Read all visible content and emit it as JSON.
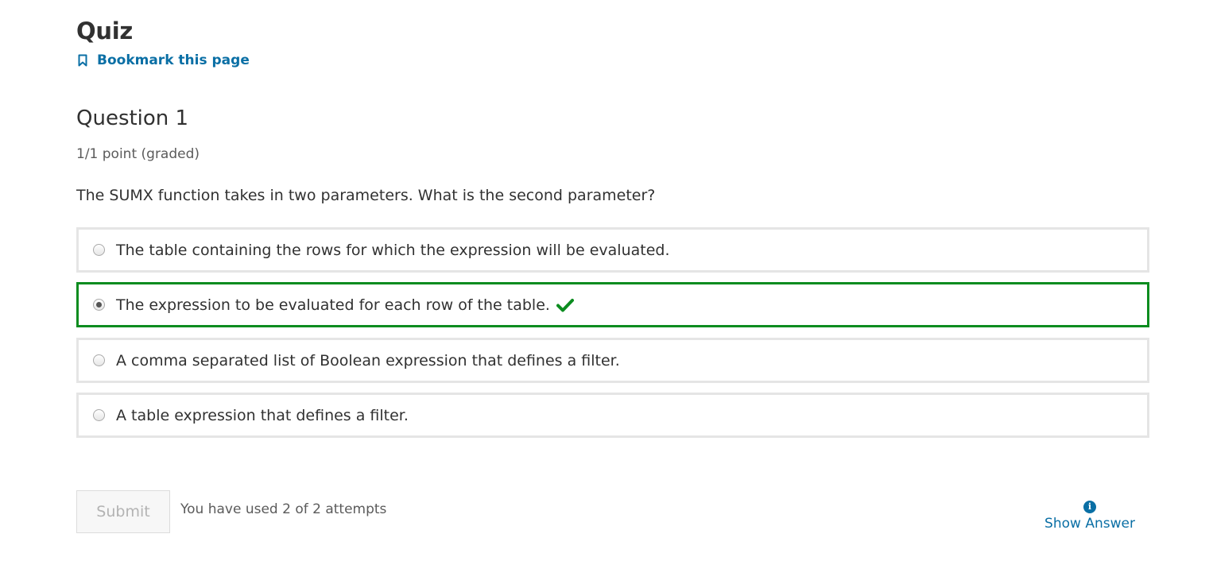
{
  "quiz": {
    "title": "Quiz",
    "bookmark_label": "Bookmark this page"
  },
  "question": {
    "title": "Question 1",
    "points": "1/1 point (graded)",
    "prompt": "The SUMX function takes in two parameters. What is the second parameter?",
    "choices": [
      {
        "label": "The table containing the rows for which the expression will be evaluated.",
        "selected": false,
        "correct": false
      },
      {
        "label": "The expression to be evaluated for each row of the table.",
        "selected": true,
        "correct": true
      },
      {
        "label": "A comma separated list of Boolean expression that defines a filter.",
        "selected": false,
        "correct": false
      },
      {
        "label": "A table expression that defines a filter.",
        "selected": false,
        "correct": false
      }
    ]
  },
  "actions": {
    "submit_label": "Submit",
    "attempts_text": "You have used 2 of 2 attempts",
    "show_answer_label": "Show Answer",
    "show_answer_icon": "info-icon",
    "info_glyph": "i"
  },
  "colors": {
    "link": "#0a6fa5",
    "correct": "#0b8c1f",
    "border": "#e5e5e5"
  }
}
